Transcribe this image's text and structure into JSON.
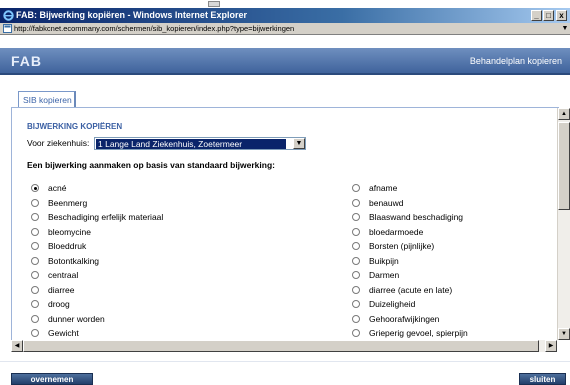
{
  "window": {
    "title": "FAB: Bijwerking kopiëren - Windows Internet Explorer",
    "minimize": "_",
    "maximize": "□",
    "close": "x",
    "address": "http://fabkcnet.ecommany.com/schermen/sib_kopieren/index.php?type=bijwerkingen"
  },
  "header": {
    "logo": "FAB",
    "title": "Behandelplan kopieren"
  },
  "tabs": [
    {
      "label": "SIB kopieren",
      "active": true
    }
  ],
  "form": {
    "section_title": "BIJWERKING KOPIËREN",
    "hospital_label": "Voor ziekenhuis:",
    "hospital_value": "1 Lange Land Ziekenhuis, Zoetermeer",
    "list_heading": "Een bijwerking aanmaken op basis van standaard bijwerking:"
  },
  "side_effects_left": [
    {
      "label": "acné",
      "checked": true
    },
    {
      "label": "Beenmerg",
      "checked": false
    },
    {
      "label": "Beschadiging erfelijk materiaal",
      "checked": false
    },
    {
      "label": "bleomycine",
      "checked": false
    },
    {
      "label": "Bloeddruk",
      "checked": false
    },
    {
      "label": "Botontkalking",
      "checked": false
    },
    {
      "label": "centraal",
      "checked": false
    },
    {
      "label": "diarree",
      "checked": false
    },
    {
      "label": "droog",
      "checked": false
    },
    {
      "label": "dunner worden",
      "checked": false
    },
    {
      "label": "Gewicht",
      "checked": false
    }
  ],
  "side_effects_right": [
    {
      "label": "afname",
      "checked": false
    },
    {
      "label": "benauwd",
      "checked": false
    },
    {
      "label": "Blaaswand beschadiging",
      "checked": false
    },
    {
      "label": "bloedarmoede",
      "checked": false
    },
    {
      "label": "Borsten (pijnlijke)",
      "checked": false
    },
    {
      "label": "Buikpijn",
      "checked": false
    },
    {
      "label": "Darmen",
      "checked": false
    },
    {
      "label": "diarree (acute en late)",
      "checked": false
    },
    {
      "label": "Duizeligheid",
      "checked": false
    },
    {
      "label": "Gehoorafwijkingen",
      "checked": false
    },
    {
      "label": "Grieperig gevoel, spierpijn",
      "checked": false
    }
  ],
  "buttons": {
    "take_over": "overnemen",
    "close": "sluiten"
  },
  "colors": {
    "titlebar": "#0a246a",
    "header": "#3f639c",
    "accent_text": "#3a5fa3",
    "button": "#233f6b"
  }
}
